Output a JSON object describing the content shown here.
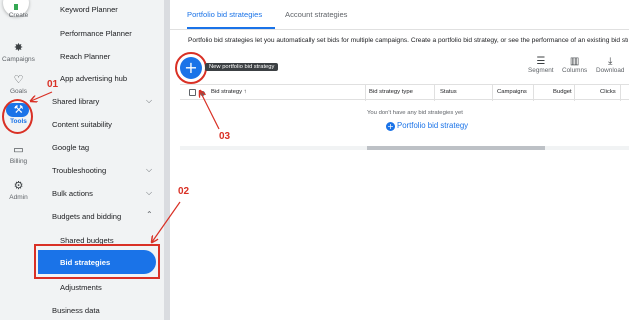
{
  "rail": {
    "items": [
      {
        "label": "Create",
        "icon": "plus-icon"
      },
      {
        "label": "Campaigns",
        "icon": "campaigns-icon"
      },
      {
        "label": "Goals",
        "icon": "trophy-icon"
      },
      {
        "label": "Tools",
        "icon": "tools-icon"
      },
      {
        "label": "Billing",
        "icon": "billing-card-icon"
      },
      {
        "label": "Admin",
        "icon": "gear-icon"
      }
    ]
  },
  "subnav": {
    "items": [
      {
        "label": "Keyword Planner"
      },
      {
        "label": "Performance Planner"
      },
      {
        "label": "Reach Planner"
      },
      {
        "label": "App advertising hub"
      },
      {
        "label": "Shared library"
      },
      {
        "label": "Content suitability"
      },
      {
        "label": "Google tag"
      },
      {
        "label": "Troubleshooting"
      },
      {
        "label": "Bulk actions"
      },
      {
        "label": "Budgets and bidding"
      },
      {
        "label": "Shared budgets"
      },
      {
        "label": "Bid strategies"
      },
      {
        "label": "Adjustments"
      },
      {
        "label": "Business data"
      }
    ]
  },
  "tabs": [
    {
      "label": "Portfolio bid strategies"
    },
    {
      "label": "Account strategies"
    }
  ],
  "description": "Portfolio bid strategies let you automatically set bids for multiple campaigns. Create a portfolio bid strategy, or see the performance of an existing bid strategy",
  "fab": {
    "symbol": "+",
    "tooltip": "New portfolio bid strategy"
  },
  "toolbar": [
    {
      "label": "Segment",
      "icon": "filter-lines-icon"
    },
    {
      "label": "Columns",
      "icon": "columns-icon"
    },
    {
      "label": "Download",
      "icon": "download-icon"
    }
  ],
  "table": {
    "columns": [
      "Bid strategy ↑",
      "Bid strategy type",
      "Status",
      "Campaigns",
      "Budget",
      "Clicks"
    ],
    "empty_text": "You don't have any bid strategies yet",
    "empty_action": "Portfolio bid strategy"
  },
  "annotations": {
    "a1": "01",
    "a2": "02",
    "a3": "03"
  },
  "colors": {
    "accent": "#1a73e8",
    "annotation": "#d93025"
  }
}
